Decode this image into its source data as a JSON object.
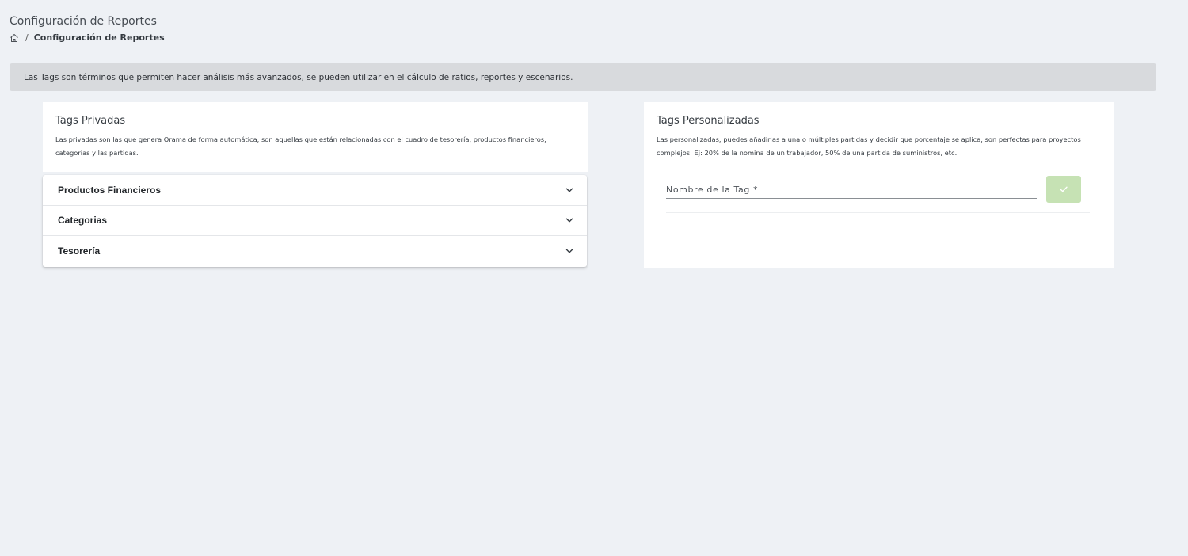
{
  "header": {
    "title": "Configuración de Reportes",
    "breadcrumb": {
      "home_icon": "home-icon",
      "separator": "/",
      "current": "Configuración de Reportes"
    }
  },
  "info": {
    "text": "Las Tags son términos que permiten hacer análisis más avanzados, se pueden utilizar en el cálculo de ratios, reportes y escenarios."
  },
  "private_tags": {
    "title": "Tags Privadas",
    "description": "Las privadas son las que genera Orama de forma automática, son aquellas que están relacionadas con el cuadro de tesorería, productos financieros, categorías y las partidas.",
    "sections": [
      {
        "label": "Productos Financieros",
        "icon": "chevron-down-icon"
      },
      {
        "label": "Categorias",
        "icon": "chevron-down-icon"
      },
      {
        "label": "Tesorería",
        "icon": "chevron-down-icon"
      }
    ]
  },
  "custom_tags": {
    "title": "Tags Personalizadas",
    "description": "Las personalizadas, puedes añadirlas a una o múltiples partidas y decidir que porcentaje se aplica, son perfectas para proyectos complejos: Ej: 20% de la nomina de un trabajador, 50% de una partida de suministros, etc.",
    "input": {
      "placeholder": "Nombre de la Tag *",
      "value": ""
    },
    "submit_icon": "check-icon",
    "submit_color": "#c6e2b4"
  },
  "colors": {
    "background": "#eef1f5",
    "alert": "#d8dadd",
    "card": "#ffffff"
  }
}
